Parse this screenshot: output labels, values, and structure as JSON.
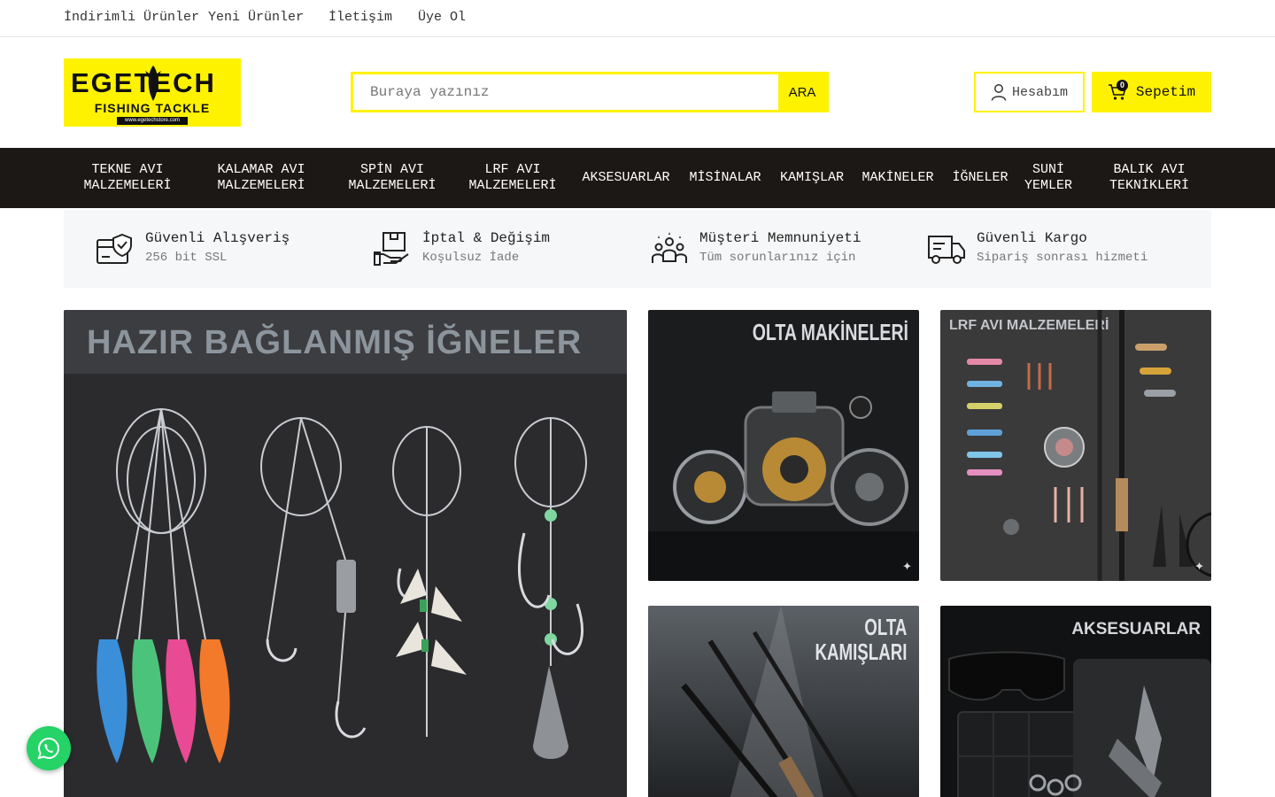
{
  "topbar": {
    "links": [
      "İndirimli Ürünler",
      "Yeni Ürünler",
      "İletişim",
      "Üye Ol"
    ]
  },
  "logo": {
    "brand": "EGETECH",
    "tagline": "FISHING TACKLE",
    "url": "www.egetechstore.com"
  },
  "search": {
    "placeholder": "Buraya yazınız",
    "button": "ARA"
  },
  "account": {
    "label": "Hesabım",
    "icon": "user-icon"
  },
  "cart": {
    "label": "Sepetim",
    "count": "0",
    "icon": "cart-icon"
  },
  "nav": {
    "items": [
      "TEKNE AVI\nMALZEMELERİ",
      "KALAMAR AVI\nMALZEMELERİ",
      "SPİN AVI\nMALZEMELERİ",
      "LRF AVI\nMALZEMELERİ",
      "AKSESUARLAR",
      "MİSİNALAR",
      "KAMIŞLAR",
      "MAKİNELER",
      "İĞNELER",
      "SUNİ\nYEMLER",
      "BALIK AVI\nTEKNİKLERİ"
    ]
  },
  "features": [
    {
      "title": "Güvenli Alışveriş",
      "subtitle": "256 bit SSL",
      "icon": "secure-card-icon"
    },
    {
      "title": "İptal & Değişim",
      "subtitle": "Koşulsuz İade",
      "icon": "return-box-icon"
    },
    {
      "title": "Müşteri Memnuniyeti",
      "subtitle": "Tüm sorunlarınız için",
      "icon": "customers-icon"
    },
    {
      "title": "Güvenli Kargo",
      "subtitle": "Sipariş sonrası hizmeti",
      "icon": "truck-icon"
    }
  ],
  "banners": {
    "main": "HAZIR BAĞLANMIŞ İĞNELER",
    "reels": "OLTA MAKİNELERİ",
    "lrf": "LRF AVI MALZEMELERİ",
    "rods": "OLTA\nKAMIŞLARI",
    "accessories": "AKSESUARLAR"
  },
  "colors": {
    "accent": "#fff200",
    "nav_bg": "#1c1815",
    "whatsapp": "#25d366"
  }
}
